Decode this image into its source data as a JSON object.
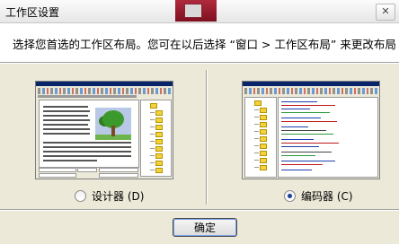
{
  "window": {
    "title": "工作区设置",
    "close_glyph": "✕"
  },
  "header": {
    "instruction": "选择您首选的工作区布局。您可在以后选择 “窗口 > 工作区布局” 来更改布局"
  },
  "options": [
    {
      "label": "设计器 (D)",
      "selected": false
    },
    {
      "label": "编码器 (C)",
      "selected": true
    }
  ],
  "footer": {
    "ok_label": "确定"
  },
  "colors": {
    "dialog_bg": "#ece9d8",
    "header_bg": "#ffffff",
    "folder": "#f4d23c",
    "radio_selected": "#1b3f9a"
  }
}
